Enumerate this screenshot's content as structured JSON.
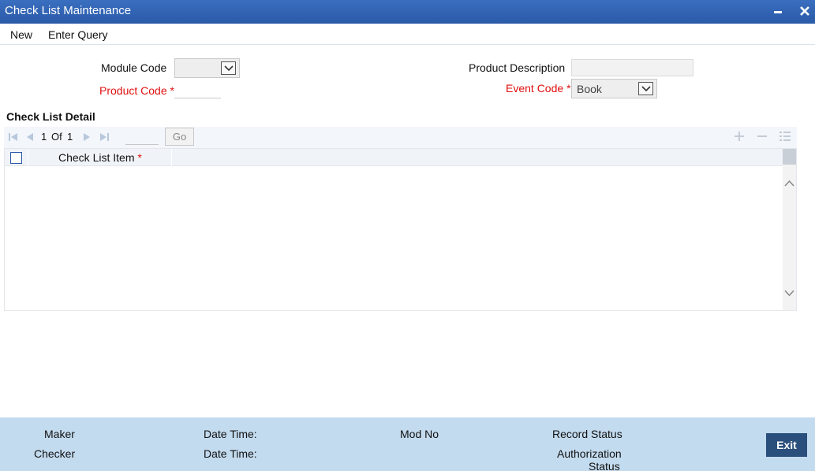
{
  "window": {
    "title": "Check List Maintenance"
  },
  "menu": {
    "new": "New",
    "enter_query": "Enter Query"
  },
  "form": {
    "module_code": {
      "label": "Module Code",
      "value": ""
    },
    "product_code": {
      "label": "Product Code",
      "required_mark": "*",
      "value": ""
    },
    "product_description": {
      "label": "Product Description",
      "value": ""
    },
    "event_code": {
      "label": "Event Code",
      "required_mark": "*",
      "value": "Book"
    }
  },
  "checklist": {
    "section_title": "Check List Detail",
    "pager": {
      "current": "1",
      "of_label": "Of",
      "total": "1",
      "go_label": "Go"
    },
    "column": {
      "label": "Check List Item",
      "required_mark": "*"
    },
    "rows": []
  },
  "footer": {
    "maker": "Maker",
    "checker": "Checker",
    "date_time_1": "Date Time:",
    "date_time_2": "Date Time:",
    "mod_no": "Mod No",
    "record_status": "Record Status",
    "authorization": "Authorization",
    "status": "Status",
    "exit": "Exit"
  },
  "colors": {
    "title_bar": "#2a5aa8",
    "required": "#e01010",
    "footer": "#c3dbef",
    "exit_button": "#2b4f7c"
  }
}
